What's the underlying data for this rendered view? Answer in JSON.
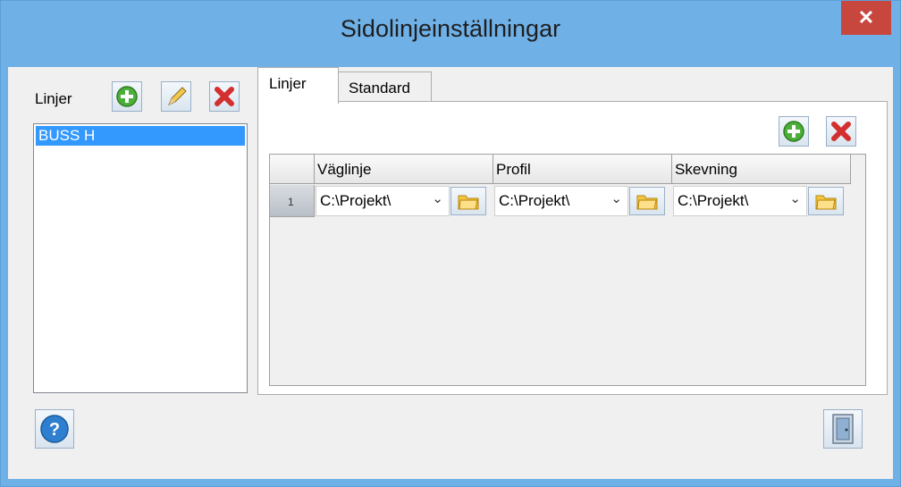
{
  "window": {
    "title": "Sidolinjeinställningar",
    "close_glyph": "✕"
  },
  "lines_panel": {
    "label": "Linjer",
    "items": [
      "BUSS H"
    ],
    "buttons": {
      "add": "add-icon",
      "edit": "pencil-icon",
      "delete": "delete-icon"
    }
  },
  "tabs": [
    {
      "label": "Linjer",
      "active": true
    },
    {
      "label": "Standard",
      "active": false
    }
  ],
  "grid": {
    "columns": [
      "Väglinje",
      "Profil",
      "Skevning"
    ],
    "rows": [
      {
        "number": "1",
        "values": [
          "C:\\Projekt\\",
          "C:\\Projekt\\",
          "C:\\Projekt\\"
        ]
      }
    ]
  },
  "colors": {
    "titlebar": "#6fb0e7",
    "close": "#c7473f",
    "selection": "#3399ff"
  }
}
